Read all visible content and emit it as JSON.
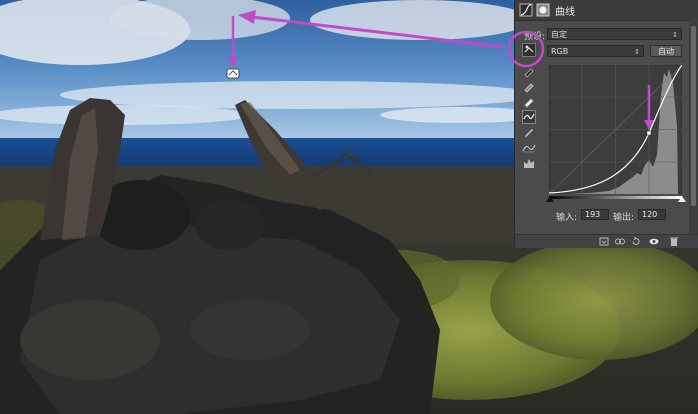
{
  "panel": {
    "title": "曲线",
    "preset_label": "预设:",
    "preset_value": "自定",
    "channel_value": "RGB",
    "auto_button": "自动",
    "input_label": "输入:",
    "input_value": "193",
    "output_label": "输出:",
    "output_value": "120"
  },
  "colors": {
    "panel_bg": "#4b4b4b",
    "annotation": "#c04bc8",
    "curve": "#ffffff"
  },
  "icons": [
    "adjustment-layer-icon",
    "mask-icon",
    "targeted-adjust-icon",
    "eyedropper-black-icon",
    "eyedropper-gray-icon",
    "eyedropper-white-icon",
    "curve-edit-icon",
    "pencil-icon",
    "smooth-icon",
    "clipping-warning-icon"
  ]
}
